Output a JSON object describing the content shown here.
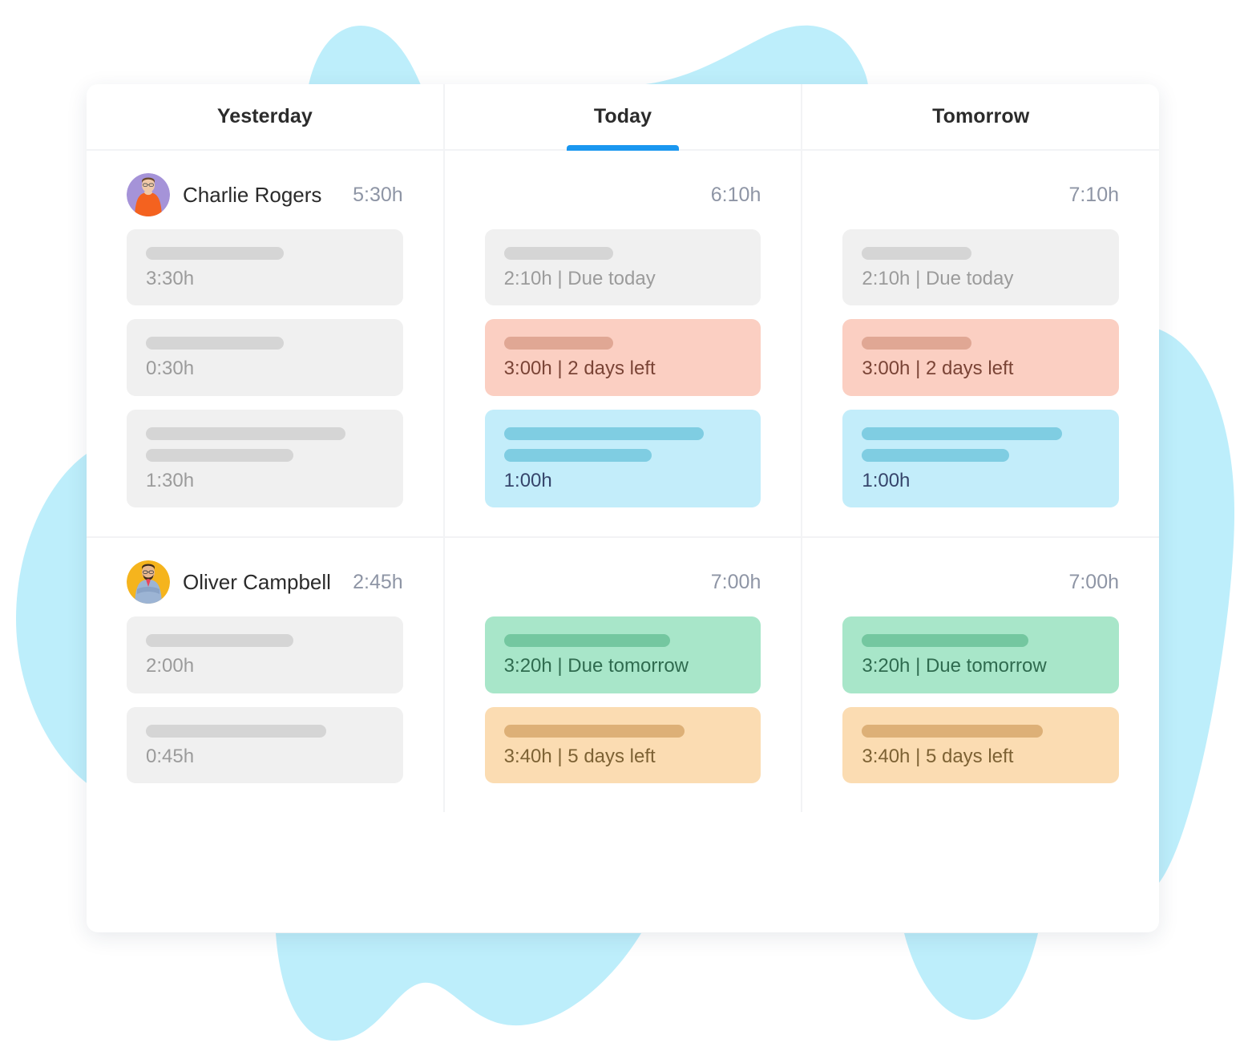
{
  "tabs": [
    {
      "label": "Yesterday",
      "active": false
    },
    {
      "label": "Today",
      "active": true
    },
    {
      "label": "Tomorrow",
      "active": false
    }
  ],
  "colors": {
    "accent": "#1a97f0",
    "blob": "#bdeefb",
    "grey_card": "#f0f0f0",
    "red_card": "#fbcfc2",
    "blue_card": "#c3edfa",
    "green_card": "#a8e6c9",
    "orange_card": "#fbdcb2",
    "name_text": "#2b2b2b",
    "muted_text": "#8e95a5"
  },
  "rows": [
    {
      "person": {
        "name": "Charlie Rogers",
        "avatar": "avatar-charlie-rogers",
        "avatar_bg": "#a593d8",
        "avatar_shirt": "#f4621f"
      },
      "cells": [
        {
          "total": "5:30h",
          "tasks": [
            {
              "theme": "grey",
              "bars": [
                58
              ],
              "meta": "3:30h"
            },
            {
              "theme": "grey",
              "bars": [
                58
              ],
              "meta": "0:30h"
            },
            {
              "theme": "grey",
              "bars": [
                84,
                62
              ],
              "meta": "1:30h"
            }
          ]
        },
        {
          "total": "6:10h",
          "tasks": [
            {
              "theme": "grey",
              "bars": [
                46
              ],
              "meta": "2:10h | Due today"
            },
            {
              "theme": "red",
              "bars": [
                46
              ],
              "meta": "3:00h | 2 days left"
            },
            {
              "theme": "blue",
              "bars": [
                84,
                62
              ],
              "meta": "1:00h"
            }
          ]
        },
        {
          "total": "7:10h",
          "tasks": [
            {
              "theme": "grey",
              "bars": [
                46
              ],
              "meta": "2:10h | Due today"
            },
            {
              "theme": "red",
              "bars": [
                46
              ],
              "meta": "3:00h | 2 days left"
            },
            {
              "theme": "blue",
              "bars": [
                84,
                62
              ],
              "meta": "1:00h"
            }
          ]
        }
      ]
    },
    {
      "person": {
        "name": "Oliver Campbell",
        "avatar": "avatar-oliver-campbell",
        "avatar_bg": "#f5b41d",
        "avatar_shirt": "#9cb4d4"
      },
      "cells": [
        {
          "total": "2:45h",
          "tasks": [
            {
              "theme": "grey",
              "bars": [
                62
              ],
              "meta": "2:00h"
            },
            {
              "theme": "grey",
              "bars": [
                76
              ],
              "meta": "0:45h"
            }
          ]
        },
        {
          "total": "7:00h",
          "tasks": [
            {
              "theme": "green",
              "bars": [
                70
              ],
              "meta": "3:20h | Due tomorrow"
            },
            {
              "theme": "orange",
              "bars": [
                76
              ],
              "meta": "3:40h | 5 days left"
            }
          ]
        },
        {
          "total": "7:00h",
          "tasks": [
            {
              "theme": "green",
              "bars": [
                70
              ],
              "meta": "3:20h | Due tomorrow"
            },
            {
              "theme": "orange",
              "bars": [
                76
              ],
              "meta": "3:40h | 5 days left"
            }
          ]
        }
      ]
    }
  ]
}
